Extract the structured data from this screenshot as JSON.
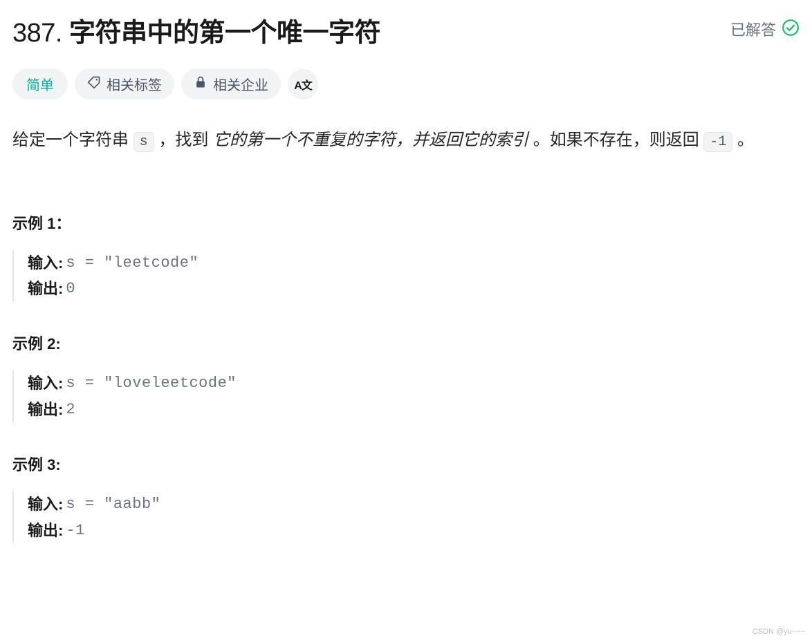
{
  "header": {
    "problem_number": "387.",
    "problem_title": "字符串中的第一个唯一字符",
    "solved_label": "已解答"
  },
  "tags": {
    "difficulty": "简单",
    "related_tags": "相关标签",
    "related_companies": "相关企业",
    "translate_icon": "A文"
  },
  "description": {
    "part1": "给定一个字符串 ",
    "code1": "s",
    "part2": " ，找到 ",
    "italic": "它的第一个不重复的字符，并返回它的索引",
    "part3": " 。如果不存在，则返回 ",
    "code2": "-1",
    "part4": " 。"
  },
  "examples": [
    {
      "title": "示例 1：",
      "input_label": "输入:",
      "input_value": " s = \"leetcode\"",
      "output_label": "输出:",
      "output_value": " 0"
    },
    {
      "title": "示例 2:",
      "input_label": "输入:",
      "input_value": " s = \"loveleetcode\"",
      "output_label": "输出:",
      "output_value": " 2"
    },
    {
      "title": "示例 3:",
      "input_label": "输入:",
      "input_value": " s = \"aabb\"",
      "output_label": "输出:",
      "output_value": " -1"
    }
  ],
  "watermark": "CSDN @yu~~~"
}
